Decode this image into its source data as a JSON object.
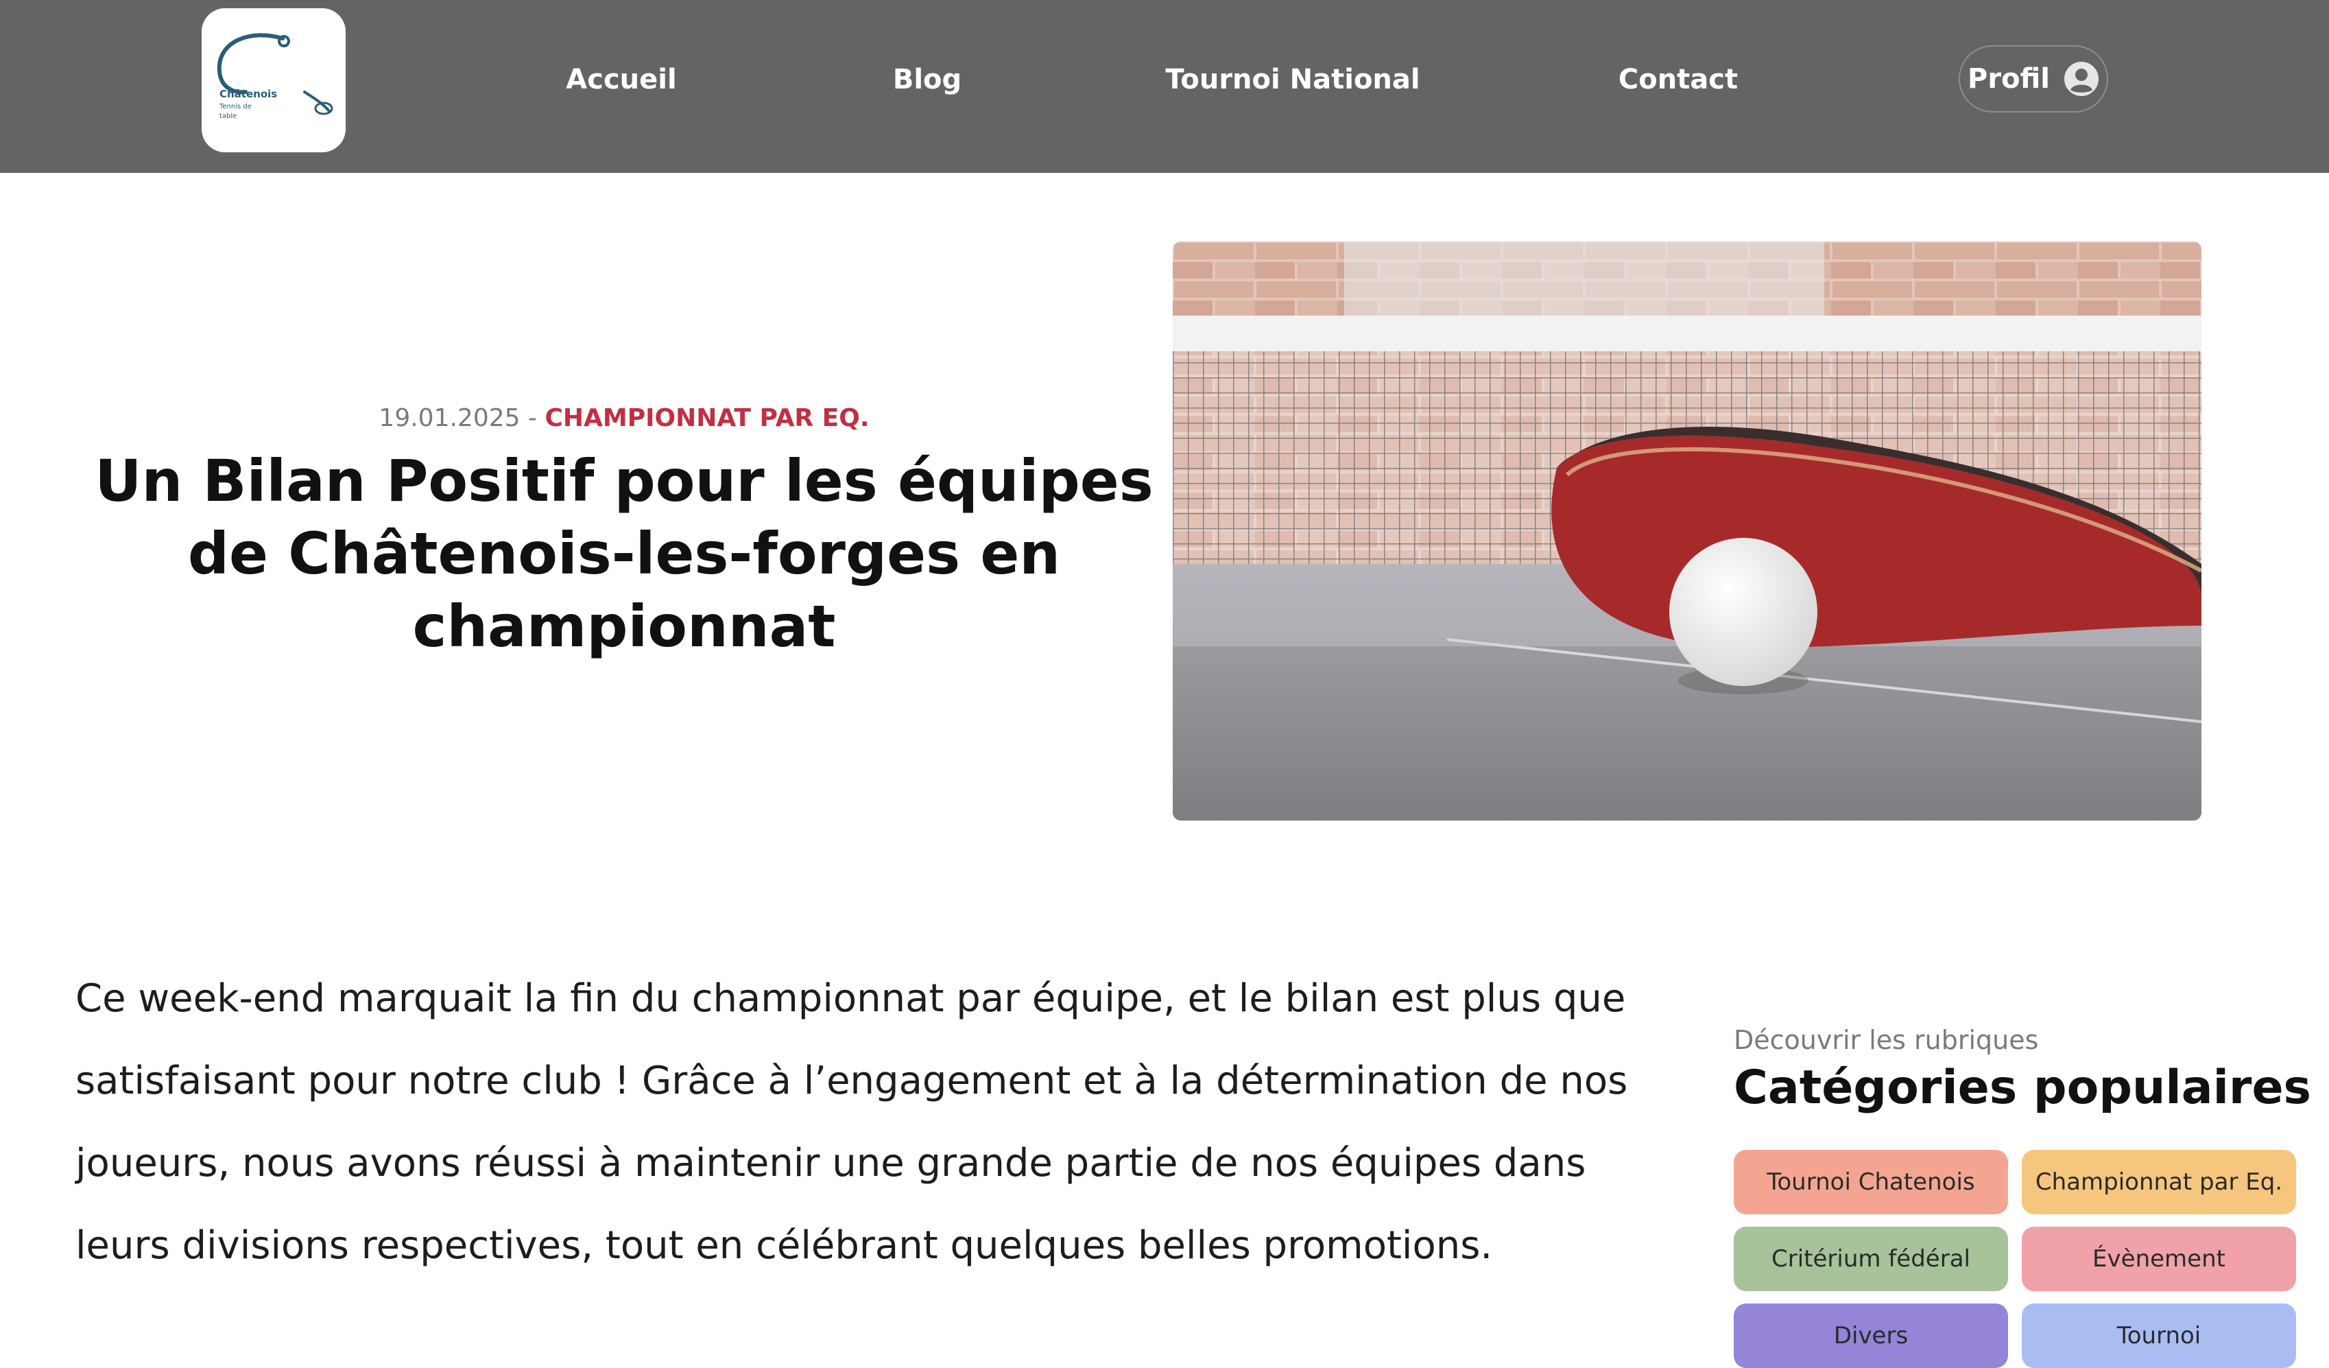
{
  "header": {
    "logo": {
      "line1": "Châtenois",
      "line2": "Tennis de",
      "line3": "table"
    },
    "nav": [
      {
        "label": "Accueil"
      },
      {
        "label": "Blog"
      },
      {
        "label": "Tournoi National"
      },
      {
        "label": "Contact"
      }
    ],
    "profile": {
      "label": "Profil",
      "icon": "user-circle-icon"
    }
  },
  "post": {
    "date": "19.01.2025",
    "separator": "-",
    "category": "CHAMPIONNAT PAR EQ.",
    "title": "Un Bilan Positif pour les équipes de Châtenois-les-forges en championnat",
    "image": "table-tennis-paddle-and-ball-photo",
    "body": "Ce week-end marquait la fin du championnat par équipe, et le bilan est plus que satisfaisant pour notre club ! Grâce à l’engagement et à la détermination de nos joueurs, nous avons réussi à maintenir une grande partie de nos équipes dans leurs divisions respectives, tout en célébrant quelques belles promotions."
  },
  "sidebar": {
    "kicker": "Découvrir les rubriques",
    "title": "Catégories populaires",
    "categories": [
      {
        "label": "Tournoi Chatenois",
        "color": "#f3a592"
      },
      {
        "label": "Championnat par Eq.",
        "color": "#f6c67e"
      },
      {
        "label": "Critérium fédéral",
        "color": "#a6c39a"
      },
      {
        "label": "Évènement",
        "color": "#f0a2a8"
      },
      {
        "label": "Divers",
        "color": "#9584d8"
      },
      {
        "label": "Tournoi",
        "color": "#a9bdf3"
      }
    ]
  },
  "colors": {
    "header_bg": "#646464",
    "accent": "#c22f42"
  }
}
